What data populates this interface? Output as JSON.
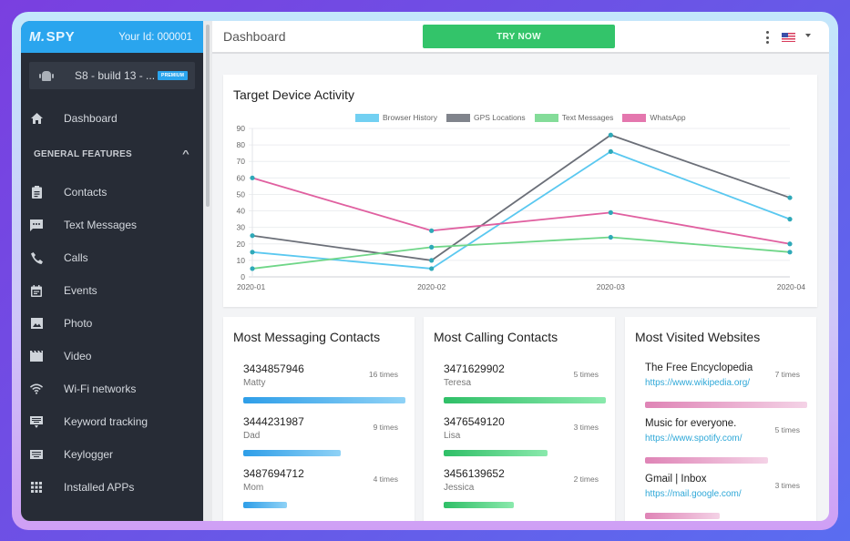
{
  "sidebar": {
    "logo": "SPY",
    "user_id": "Your Id: 000001",
    "device_name": "S8 - build 13 - ...",
    "device_badge": "PREMIUM",
    "dashboard_label": "Dashboard",
    "section_label": "GENERAL FEATURES",
    "items": [
      {
        "label": "Contacts",
        "icon": "clipboard-icon"
      },
      {
        "label": "Text Messages",
        "icon": "message-icon"
      },
      {
        "label": "Calls",
        "icon": "phone-icon"
      },
      {
        "label": "Events",
        "icon": "calendar-icon"
      },
      {
        "label": "Photo",
        "icon": "image-icon"
      },
      {
        "label": "Video",
        "icon": "video-icon"
      },
      {
        "label": "Wi-Fi networks",
        "icon": "wifi-icon"
      },
      {
        "label": "Keyword tracking",
        "icon": "keyboard-monitor-icon"
      },
      {
        "label": "Keylogger",
        "icon": "keyboard-icon"
      },
      {
        "label": "Installed APPs",
        "icon": "apps-grid-icon"
      }
    ]
  },
  "header": {
    "title": "Dashboard",
    "try_now": "TRY NOW",
    "language": "US"
  },
  "chart_data": {
    "type": "line",
    "title": "Target Device Activity",
    "x": [
      "2020-01",
      "2020-02",
      "2020-03",
      "2020-04"
    ],
    "ylim": [
      0,
      90
    ],
    "yticks": [
      0,
      10,
      20,
      30,
      40,
      50,
      60,
      70,
      80,
      90
    ],
    "grid": true,
    "legend_position": "top",
    "series": [
      {
        "name": "Browser History",
        "color": "#5ac8f0",
        "values": [
          15,
          5,
          76,
          35
        ]
      },
      {
        "name": "GPS Locations",
        "color": "#6b6f78",
        "values": [
          25,
          10,
          86,
          48
        ]
      },
      {
        "name": "Text Messages",
        "color": "#6fd688",
        "values": [
          5,
          18,
          24,
          15
        ]
      },
      {
        "name": "WhatsApp",
        "color": "#e060a0",
        "values": [
          60,
          28,
          39,
          20
        ]
      }
    ],
    "point_color": "#2fa9b8"
  },
  "messaging": {
    "title": "Most Messaging Contacts",
    "entries": [
      {
        "number": "3434857946",
        "name": "Matty",
        "times": "16 times",
        "fraction": 1.0
      },
      {
        "number": "3444231987",
        "name": "Dad",
        "times": "9 times",
        "fraction": 0.6
      },
      {
        "number": "3487694712",
        "name": "Mom",
        "times": "4 times",
        "fraction": 0.27
      }
    ]
  },
  "calling": {
    "title": "Most Calling Contacts",
    "entries": [
      {
        "number": "3471629902",
        "name": "Teresa",
        "times": "5 times",
        "fraction": 1.0
      },
      {
        "number": "3476549120",
        "name": "Lisa",
        "times": "3 times",
        "fraction": 0.64
      },
      {
        "number": "3456139652",
        "name": "Jessica",
        "times": "2 times",
        "fraction": 0.43
      }
    ]
  },
  "websites": {
    "title": "Most Visited Websites",
    "entries": [
      {
        "title": "The Free Encyclopedia",
        "url": "https://www.wikipedia.org/",
        "times": "7 times",
        "fraction": 1.0
      },
      {
        "title": "Music for everyone.",
        "url": "https://www.spotify.com/",
        "times": "5 times",
        "fraction": 0.76
      },
      {
        "title": "Gmail | Inbox",
        "url": "https://mail.google.com/",
        "times": "3 times",
        "fraction": 0.46
      }
    ]
  }
}
